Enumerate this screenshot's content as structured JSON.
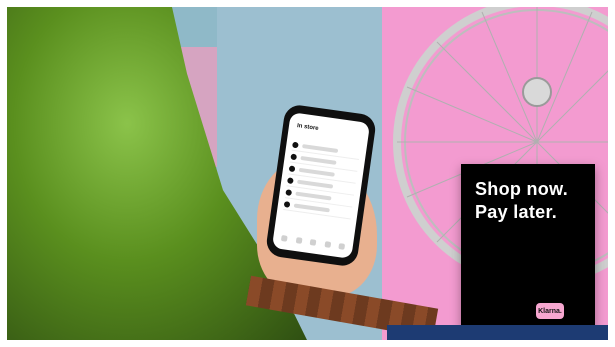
{
  "scene": {
    "colors": {
      "coat": "#5a8f1e",
      "wall_blue": "#9cbfd0",
      "wall_pink": "#f39bd0",
      "sign_bg": "#000000",
      "logo_bg": "#f7a7d0"
    }
  },
  "phone": {
    "app_title": "In store"
  },
  "sign": {
    "line1": "Shop now.",
    "line2": "Pay later.",
    "logo": "Klarna."
  }
}
